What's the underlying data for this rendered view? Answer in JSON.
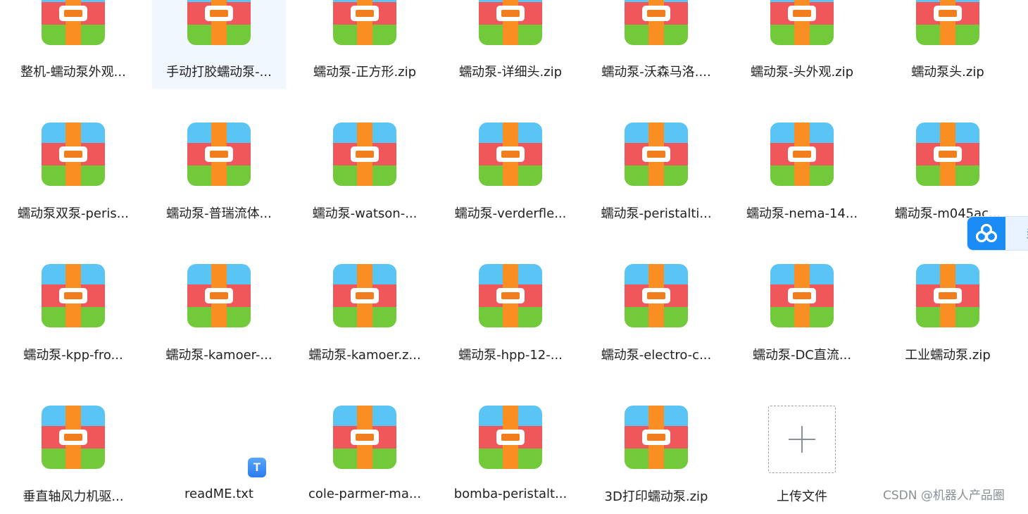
{
  "files": [
    {
      "name": "整机-蠕动泵外观...",
      "type": "zip"
    },
    {
      "name": "手动打胶蠕动泵-...",
      "type": "zip",
      "selected": true
    },
    {
      "name": "蠕动泵-正方形.zip",
      "type": "zip"
    },
    {
      "name": "蠕动泵-详细头.zip",
      "type": "zip"
    },
    {
      "name": "蠕动泵-沃森马洛....",
      "type": "zip"
    },
    {
      "name": "蠕动泵-头外观.zip",
      "type": "zip"
    },
    {
      "name": "蠕动泵头.zip",
      "type": "zip"
    },
    {
      "name": "蠕动泵双泵-peris...",
      "type": "zip"
    },
    {
      "name": "蠕动泵-普瑞流体...",
      "type": "zip"
    },
    {
      "name": "蠕动泵-watson-...",
      "type": "zip"
    },
    {
      "name": "蠕动泵-verderfle...",
      "type": "zip"
    },
    {
      "name": "蠕动泵-peristalti...",
      "type": "zip"
    },
    {
      "name": "蠕动泵-nema-14...",
      "type": "zip"
    },
    {
      "name": "蠕动泵-m045ac...",
      "type": "zip"
    },
    {
      "name": "蠕动泵-kpp-fro...",
      "type": "zip"
    },
    {
      "name": "蠕动泵-kamoer-...",
      "type": "zip"
    },
    {
      "name": "蠕动泵-kamoer.z...",
      "type": "zip"
    },
    {
      "name": "蠕动泵-hpp-12-...",
      "type": "zip"
    },
    {
      "name": "蠕动泵-electro-c...",
      "type": "zip"
    },
    {
      "name": "蠕动泵-DC直流...",
      "type": "zip"
    },
    {
      "name": "工业蠕动泵.zip",
      "type": "zip"
    },
    {
      "name": "垂直轴风力机驱...",
      "type": "zip"
    },
    {
      "name": "readME.txt",
      "type": "txt",
      "badge": "T"
    },
    {
      "name": "cole-parmer-ma...",
      "type": "zip"
    },
    {
      "name": "bomba-peristalt...",
      "type": "zip"
    },
    {
      "name": "3D打印蠕动泵.zip",
      "type": "zip"
    }
  ],
  "upload": {
    "label": "上传文件",
    "icon": "plus-icon"
  },
  "cloud_widget": {
    "icon": "cloud-icon",
    "partial_text": "封"
  },
  "watermark": "CSDN @机器人产品圈",
  "colors": {
    "zip_top": "#5ac4f4",
    "zip_middle": "#f0575a",
    "zip_bottom": "#72c93a",
    "zip_band": "#f98e22",
    "selected_bg": "#f1f7fe",
    "accent": "#1b8cf5"
  }
}
